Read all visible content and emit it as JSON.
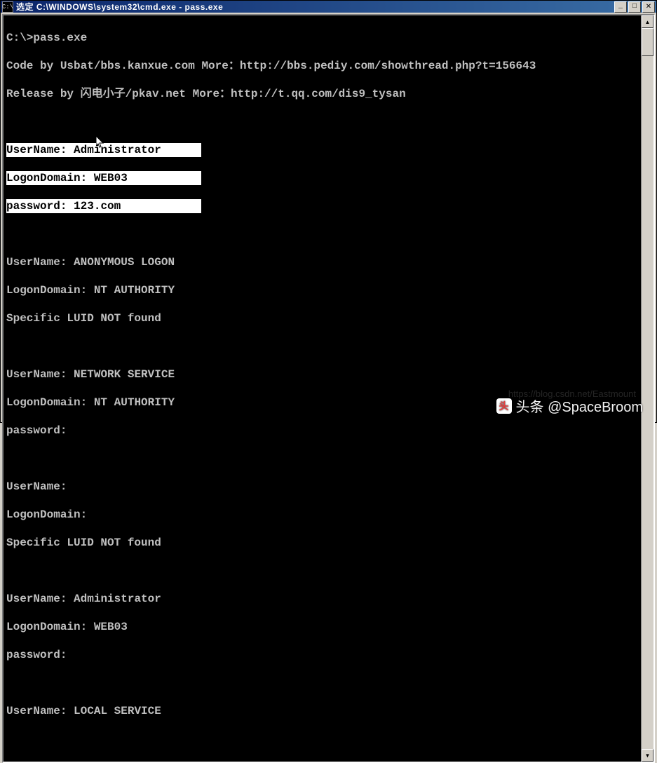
{
  "window": {
    "icon_label": "C:\\",
    "title": "选定 C:\\WINDOWS\\system32\\cmd.exe - pass.exe",
    "buttons": {
      "minimize": "_",
      "maximize": "□",
      "close": "✕"
    }
  },
  "terminal": {
    "prompt": "C:\\>pass.exe",
    "credit1": "Code by Usbat/bbs.kanxue.com More：http://bbs.pediy.com/showthread.php?t=156643",
    "credit2": "Release by 闪电小子/pkav.net More：http://t.qq.com/dis9_tysan",
    "blocks": [
      {
        "user_label": "UserName:",
        "user": "Administrator",
        "domain_label": "LogonDomain:",
        "domain": "WEB03",
        "pw_label": "password:",
        "pw": "123.com",
        "highlighted": true
      },
      {
        "user_label": "UserName:",
        "user": "ANONYMOUS LOGON",
        "domain_label": "LogonDomain:",
        "domain": "NT AUTHORITY",
        "note": "Specific LUID NOT found"
      },
      {
        "user_label": "UserName:",
        "user": "NETWORK SERVICE",
        "domain_label": "LogonDomain:",
        "domain": "NT AUTHORITY",
        "pw_label": "password:",
        "pw": ""
      },
      {
        "user_label": "UserName:",
        "user": "",
        "domain_label": "LogonDomain:",
        "domain": "",
        "note": "Specific LUID NOT found"
      },
      {
        "user_label": "UserName:",
        "user": "Administrator",
        "domain_label": "LogonDomain:",
        "domain": "WEB03",
        "pw_label": "password:",
        "pw": ""
      },
      {
        "user_label": "UserName:",
        "user": "LOCAL SERVICE"
      }
    ]
  },
  "watermark": {
    "main": "头条 @SpaceBroom",
    "faint": "https://blog.csdn.net/Eastmount"
  }
}
